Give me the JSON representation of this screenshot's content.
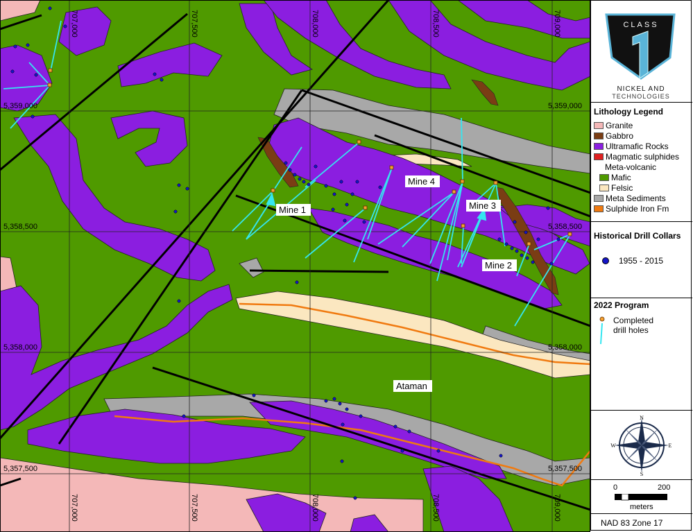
{
  "map": {
    "grid_labels": {
      "eastings": [
        "707,000",
        "707,500",
        "708,000",
        "708,500",
        "709,000"
      ],
      "northings_left": [
        "5,359,000",
        "5,358,500",
        "5,358,000",
        "5,357,500"
      ],
      "northings_right": [
        "5,359,000",
        "5,358,500",
        "5,358,000",
        "5,357,500"
      ]
    },
    "place_labels": {
      "mine1": "Mine 1",
      "mine2": "Mine 2",
      "mine3": "Mine 3",
      "mine4": "Mine 4",
      "ataman": "Ataman"
    }
  },
  "logo": {
    "word": "CLASS",
    "numeral": "1",
    "tagline_1": "NICKEL AND",
    "tagline_2": "TECHNOLOGIES"
  },
  "legend": {
    "title": "Lithology Legend",
    "items": [
      {
        "label": "Granite",
        "color": "#f4b8b8"
      },
      {
        "label": "Gabbro",
        "color": "#7a3d14"
      },
      {
        "label": "Ultramafic Rocks",
        "color": "#8b1ee0"
      },
      {
        "label": "Magmatic sulphides",
        "color": "#e02020"
      }
    ],
    "subheading": "Meta-volcanic",
    "sub_items": [
      {
        "label": "Mafic",
        "color": "#4f9a00"
      },
      {
        "label": "Felsic",
        "color": "#fbe7c0"
      }
    ],
    "more_items": [
      {
        "label": "Meta Sediments",
        "color": "#a8a8a8"
      },
      {
        "label": "Sulphide Iron Fm",
        "color": "#f07a10"
      }
    ],
    "historical": {
      "title": "Historical Drill Collars",
      "label": "1955 - 2015",
      "color": "#1414c8"
    },
    "program": {
      "title": "2022 Program",
      "label_1": "Completed",
      "label_2": "drill holes",
      "collar_color": "#f5a030",
      "hole_color": "#35e6f0"
    },
    "compass": {
      "n": "N",
      "s": "S",
      "e": "E",
      "w": "W"
    },
    "scale": {
      "zero": "0",
      "max": "200",
      "unit": "meters"
    },
    "datum": "NAD 83 Zone 17"
  },
  "colors": {
    "mafic": "#4f9a00",
    "ultramafic": "#8b1ee0",
    "granite": "#f4b8b8",
    "sediments": "#a8a8a8",
    "felsic": "#fbe7c0",
    "gabbro": "#7a3d14",
    "iron": "#f07a10"
  }
}
